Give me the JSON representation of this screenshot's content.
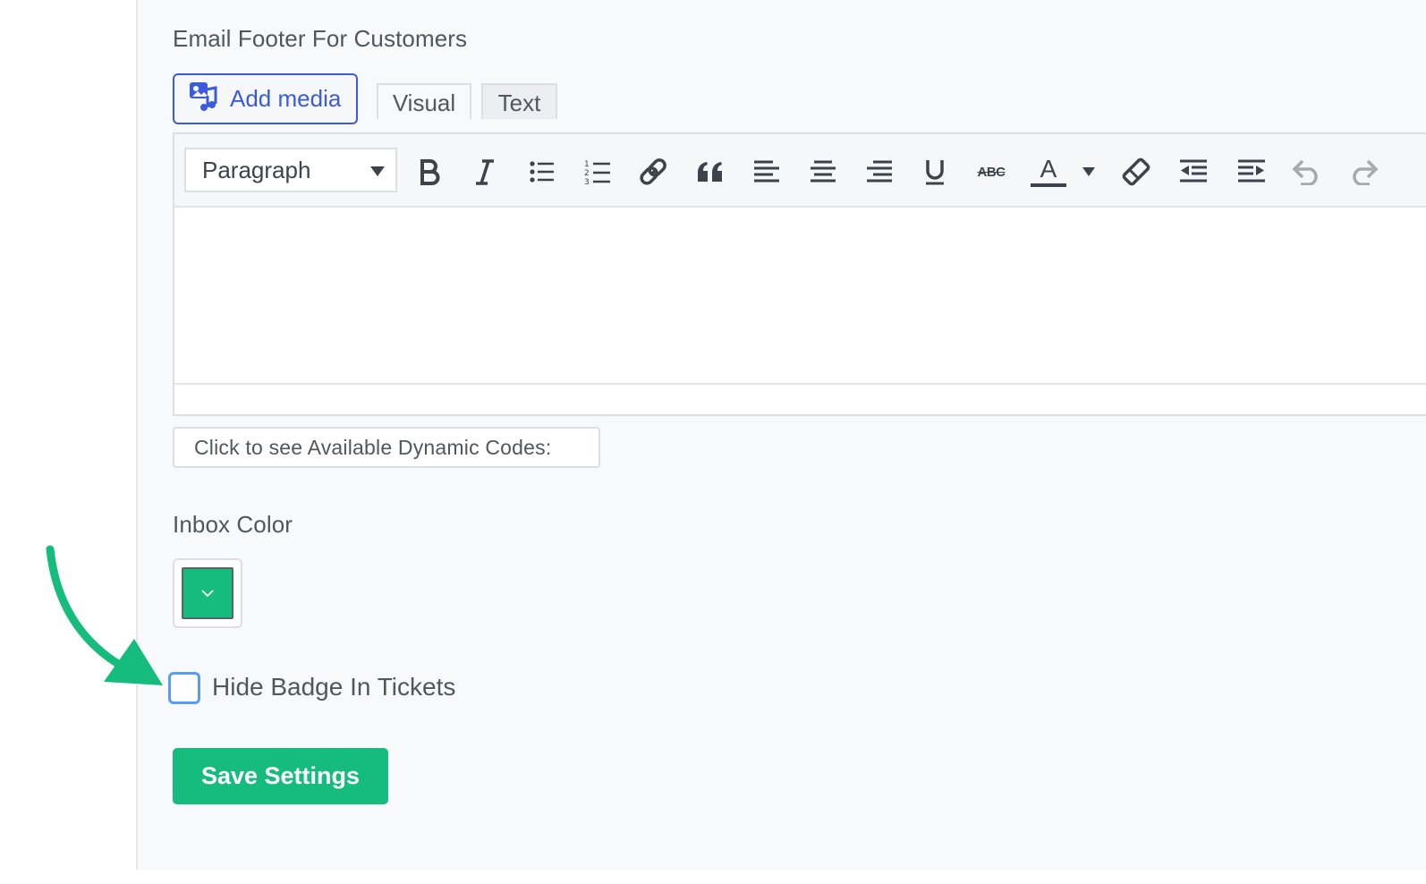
{
  "email_footer": {
    "label": "Email Footer For Customers",
    "add_media_label": "Add media",
    "tabs": [
      {
        "label": "Visual"
      },
      {
        "label": "Text"
      }
    ],
    "format_select": {
      "value": "Paragraph"
    },
    "toolbar_icons": [
      "bold-icon",
      "italic-icon",
      "bulleted-list-icon",
      "numbered-list-icon",
      "link-icon",
      "blockquote-icon",
      "align-left-icon",
      "align-center-icon",
      "align-right-icon",
      "underline-icon",
      "strikethrough-icon",
      "text-color-icon",
      "clear-formatting-icon",
      "outdent-icon",
      "indent-icon",
      "undo-icon",
      "redo-icon"
    ],
    "strikethrough_glyph": "ABC",
    "text_color_glyph": "A",
    "editor_content": "",
    "dynamic_codes_label": "Click to see Available Dynamic Codes:"
  },
  "inbox_color": {
    "label": "Inbox Color",
    "value": "#16bc7d"
  },
  "hide_badge": {
    "label": "Hide Badge In Tickets",
    "checked": false
  },
  "save_button": {
    "label": "Save Settings"
  },
  "colors": {
    "accent_green": "#16bc7d",
    "link_blue": "#3b5bdb",
    "focus_blue": "#5a9cf0",
    "text": "#50575e"
  }
}
